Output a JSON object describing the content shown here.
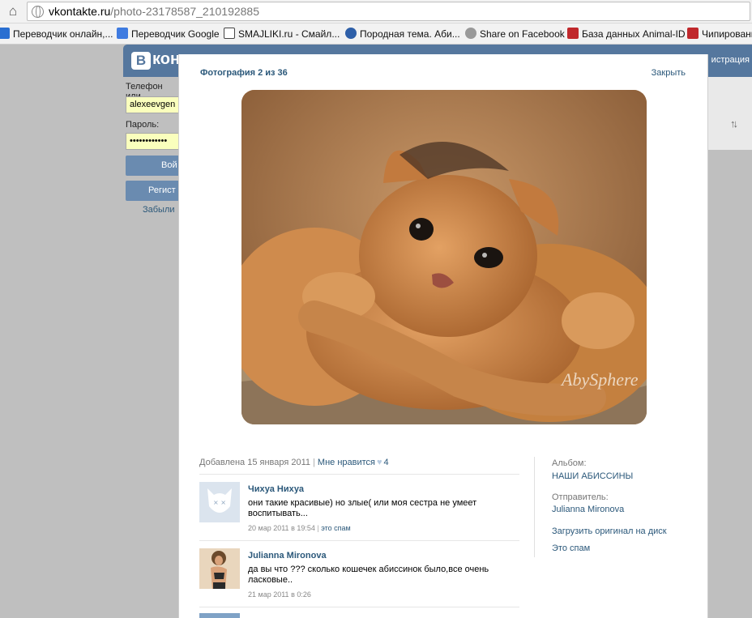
{
  "browser": {
    "url_host": "vkontakte.ru",
    "url_path": "/photo-23178587_210192885",
    "bookmarks": [
      {
        "label": "Переводчик онлайн,...",
        "icon": "translator-icon",
        "color": "#2a6fd1"
      },
      {
        "label": "Переводчик Google",
        "icon": "google-translate-icon",
        "color": "#3f7be0"
      },
      {
        "label": "SMAJLIKI.ru - Смайл...",
        "icon": "smiley-icon",
        "color": "#444444"
      },
      {
        "label": "Породная тема. Аби...",
        "icon": "forum-icon",
        "color": "#2e5fa8"
      },
      {
        "label": "Share on Facebook",
        "icon": "globe-icon",
        "color": "#777777"
      },
      {
        "label": "База данных Animal-ID",
        "icon": "paw-icon",
        "color": "#c0282c"
      },
      {
        "label": "Чипирование",
        "icon": "paw-icon",
        "color": "#c0282c"
      }
    ]
  },
  "vk": {
    "logo_letter": "В",
    "logo_text": "кон",
    "registration_link": "истрация",
    "phone_label": "Телефон или",
    "phone_value": "alexeevgen",
    "password_label": "Пароль:",
    "password_value": "••••••••••••",
    "login_button": "Вой",
    "register_button": "Регист",
    "forgot_link": "Забыли"
  },
  "photo_view": {
    "title": "Фотография 2 из 36",
    "close_label": "Закрыть",
    "watermark": "AbySphere",
    "added_label": "Добавлена 15 января 2011",
    "like_label": "Мне нравится",
    "like_count": "4",
    "comments": [
      {
        "author": "Чихуа Нихуа",
        "text": "они такие красивые) но злые( или моя сестра не умеет воспитывать...",
        "date": "20 мар 2011 в 19:54",
        "spam": "это спам"
      },
      {
        "author": "Julianna Mironova",
        "text": "да вы что ??? сколько кошечек абиссинок было,все очень ласковые..",
        "date": "21 мар 2011 в 0:26",
        "spam": ""
      }
    ],
    "sidebar": {
      "album_label": "Альбом:",
      "album_name": "НАШИ АБИССИНЫ",
      "sender_label": "Отправитель:",
      "sender_name": "Julianna Mironova",
      "download_link": "Загрузить оригинал на диск",
      "spam_link": "Это спам"
    }
  }
}
